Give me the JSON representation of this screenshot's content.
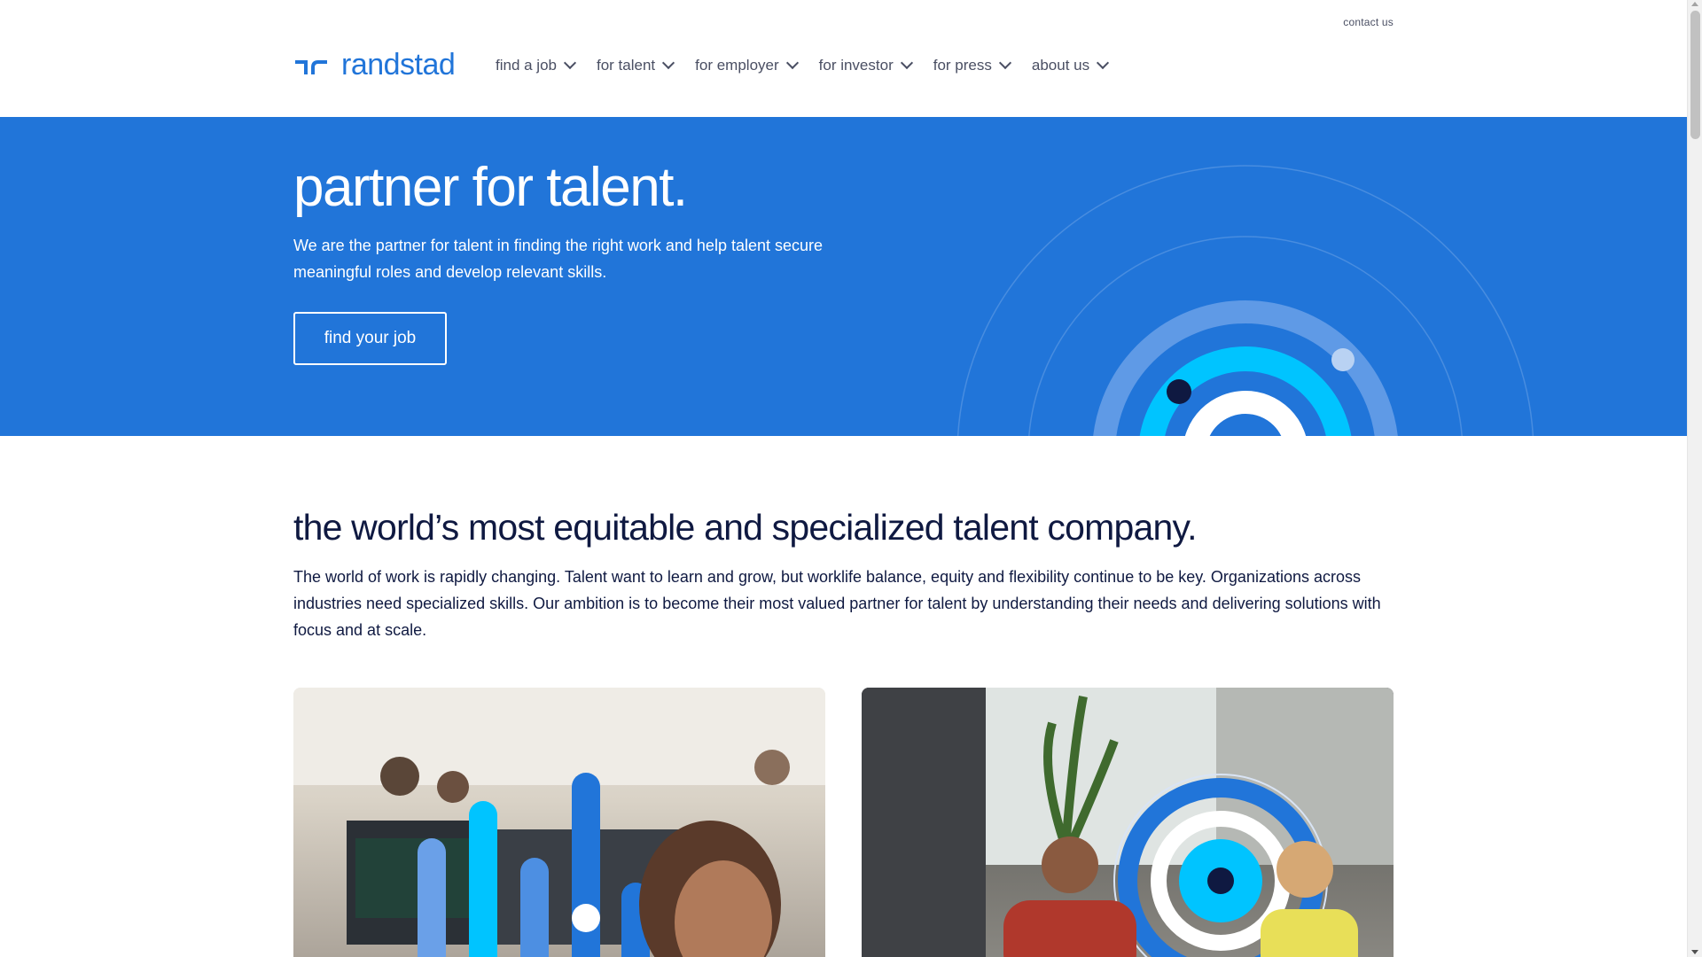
{
  "header": {
    "contact_label": "contact us",
    "logo_text": "randstad",
    "nav": [
      {
        "label": "find a job"
      },
      {
        "label": "for talent"
      },
      {
        "label": "for employer"
      },
      {
        "label": "for investor"
      },
      {
        "label": "for press"
      },
      {
        "label": "about us"
      }
    ]
  },
  "hero": {
    "title": "partner for talent.",
    "text": "We are the partner for talent in finding the right work and help talent secure meaningful roles and develop relevant skills.",
    "button_label": "find your job"
  },
  "intro": {
    "title": "the world’s most equitable and specialized talent company.",
    "text": "The world of work is rapidly changing. Talent want to learn and grow, but worklife balance, equity and flexibility continue to be key. Organizations across industries need specialized skills. Our ambition is to become their most valued partner for talent by understanding their needs and delivering solutions with focus and at scale."
  },
  "colors": {
    "brand_blue": "#2175d9",
    "navy": "#0f1941",
    "cyan": "#00c4ff",
    "text_gray": "#4a4f63"
  },
  "icons": [
    "chevron-down-icon",
    "randstad-logo-icon",
    "talent-orbit-graphic"
  ]
}
